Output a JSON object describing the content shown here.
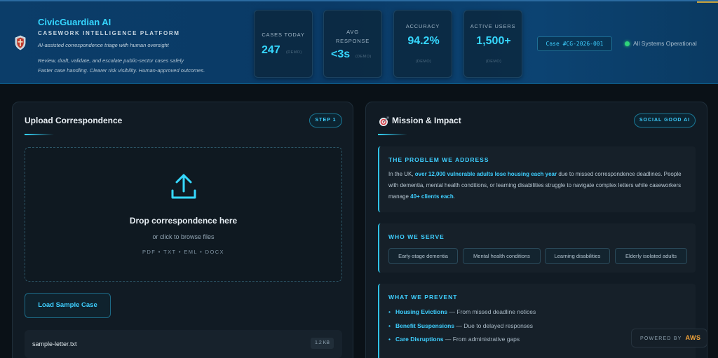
{
  "header": {
    "brand_title": "CivicGuardian AI",
    "brand_subtitle": "CASEWORK INTELLIGENCE PLATFORM",
    "tagline": "AI-assisted correspondence triage with human oversight",
    "desc_line1": "Review, draft, validate, and escalate public-sector cases safely",
    "desc_line2": "Faster case handling. Clearer risk visibility. Human-approved outcomes.",
    "case_id": "Case #CG-2026-001",
    "status": "All Systems Operational",
    "stats": [
      {
        "label": "CASES TODAY",
        "value": "247",
        "note": "(DEMO)"
      },
      {
        "label": "AVG RESPONSE",
        "value": "<3s",
        "note": "(DEMO)"
      },
      {
        "label": "ACCURACY",
        "value": "94.2%",
        "note": "(DEMO)"
      },
      {
        "label": "ACTIVE USERS",
        "value": "1,500+",
        "note": "(DEMO)"
      }
    ]
  },
  "upload": {
    "title": "Upload Correspondence",
    "step": "STEP 1",
    "drop_title": "Drop correspondence here",
    "drop_sub": "or click to browse files",
    "file_types": "PDF • TXT • EML • DOCX",
    "sample_button": "Load Sample Case",
    "file_name": "sample-letter.txt",
    "file_size": "1.2 KB"
  },
  "mission": {
    "title": "Mission & Impact",
    "badge": "SOCIAL GOOD AI",
    "problem": {
      "heading": "THE PROBLEM WE ADDRESS",
      "t1": "In the UK, ",
      "t2": "over 12,000 vulnerable adults lose housing each year",
      "t3": " due to missed correspondence deadlines. People with dementia, mental health conditions, or learning disabilities struggle to navigate complex letters while caseworkers manage ",
      "t4": "40+ clients each",
      "t5": "."
    },
    "serve": {
      "heading": "WHO WE SERVE",
      "tags": [
        "Early-stage dementia",
        "Mental health conditions",
        "Learning disabilities",
        "Elderly isolated adults"
      ]
    },
    "prevent": {
      "heading": "WHAT WE PREVENT",
      "items": [
        {
          "name": "Housing Evictions",
          "detail": " — From missed deadline notices"
        },
        {
          "name": "Benefit Suspensions",
          "detail": " — Due to delayed responses"
        },
        {
          "name": "Care Disruptions",
          "detail": " — From administrative gaps"
        }
      ]
    }
  },
  "footer": {
    "powered_by": "POWERED BY",
    "provider": "AWS"
  },
  "colors": {
    "accent": "#36d8ff",
    "status_green": "#2fd47a",
    "aws_orange": "#f2a43a"
  },
  "icons": {
    "logo": "shield-icon",
    "upload": "upload-icon",
    "mission": "target-icon",
    "status": "status-dot-icon"
  }
}
